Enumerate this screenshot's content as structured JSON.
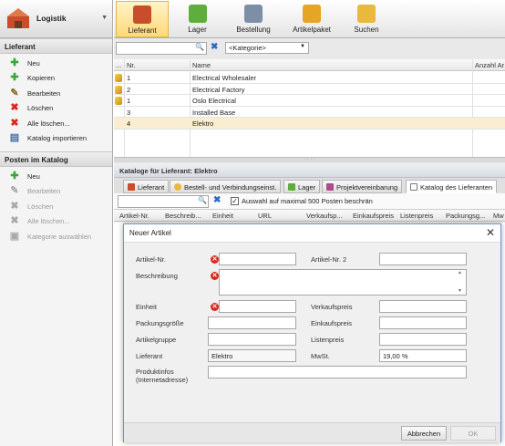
{
  "sidebar": {
    "app_title": "Logistik",
    "lieferant_section": "Lieferant",
    "lieferant_items": [
      {
        "label": "Neu"
      },
      {
        "label": "Kopieren"
      },
      {
        "label": "Bearbeiten"
      },
      {
        "label": "Löschen"
      },
      {
        "label": "Alle löschen..."
      },
      {
        "label": "Katalog importieren"
      }
    ],
    "posten_section": "Posten im Katalog",
    "posten_items": [
      {
        "label": "Neu"
      },
      {
        "label": "Bearbeiten"
      },
      {
        "label": "Löschen"
      },
      {
        "label": "Alle löschen..."
      },
      {
        "label": "Kategorie auswählen"
      }
    ]
  },
  "toolbar": {
    "buttons": [
      {
        "label": "Lieferant",
        "active": true
      },
      {
        "label": "Lager"
      },
      {
        "label": "Bestellung"
      },
      {
        "label": "Artikelpaket"
      },
      {
        "label": "Suchen"
      }
    ]
  },
  "filter": {
    "kategorie": "<Kategorie>"
  },
  "grid": {
    "columns": [
      "Nr.",
      "Name",
      "Anzahl Ar"
    ],
    "rows": [
      {
        "nr": "1",
        "name": "Electrical Wholesaler"
      },
      {
        "nr": "2",
        "name": "Electrical Factory"
      },
      {
        "nr": "1",
        "name": "Oslo Electrical"
      },
      {
        "nr": "3",
        "name": "Installed Base"
      },
      {
        "nr": "4",
        "name": "Elektro"
      }
    ]
  },
  "lower": {
    "title": "Kataloge für Lieferant: Elektro",
    "tabs": [
      "Lieferant",
      "Bestell- und Verbindungseinst.",
      "Lager",
      "Projektvereinbarung",
      "Katalog des Lieferanten"
    ],
    "checkbox_label": "Auswahl auf maximal 500 Posten beschrän",
    "columns": [
      "Artikel-Nr.",
      "Beschreib...",
      "Einheit",
      "URL",
      "Verkaufsp...",
      "Einkaufspreis",
      "Listenpreis",
      "Packungsg...",
      "Mw"
    ]
  },
  "dialog": {
    "title": "Neuer Artikel",
    "labels": {
      "artikel_nr": "Artikel-Nr.",
      "artikel_nr2": "Artikel-Nr. 2",
      "beschreibung": "Beschreibung",
      "einheit": "Einheit",
      "verkaufspreis": "Verkaufspreis",
      "packungsgroesse": "Packungsgröße",
      "einkaufspreis": "Einkaufspreis",
      "artikelgruppe": "Artikelgruppe",
      "listenpreis": "Listenpreis",
      "lieferant": "Lieferant",
      "mwst": "MwSt.",
      "produktinfos": "Produktinfos (Internetadresse)"
    },
    "values": {
      "lieferant": "Elektro",
      "mwst": "19,00 %"
    },
    "buttons": {
      "abbrechen": "Abbrechen",
      "ok": "OK"
    }
  },
  "colors": {
    "accent": "#ffd978",
    "error": "#d8291a",
    "add": "#3aa535"
  }
}
